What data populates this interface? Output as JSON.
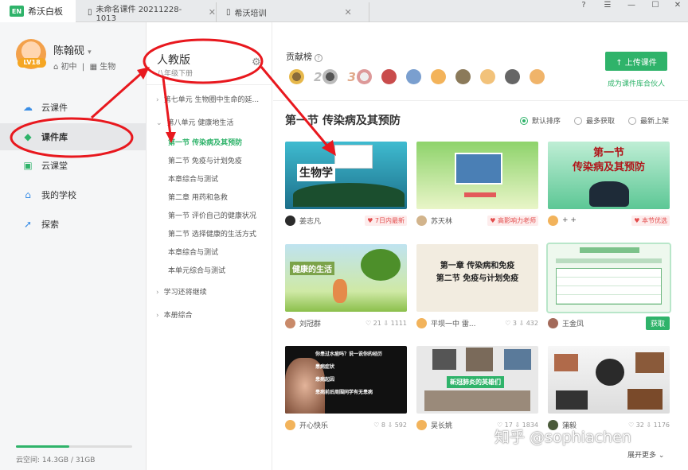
{
  "app": {
    "logo": "EN",
    "name": "希沃白板"
  },
  "tabs": [
    {
      "label": "未命名课件 20211228-1013"
    },
    {
      "label": "希沃培训"
    }
  ],
  "window_controls": {
    "help": "?",
    "min": "—",
    "close": "✕"
  },
  "user": {
    "name": "陈翰砚",
    "level": "LV18",
    "grade": "初中",
    "subject": "生物"
  },
  "nav": [
    {
      "label": "云课件",
      "icon": "cloud-icon"
    },
    {
      "label": "课件库",
      "icon": "library-icon"
    },
    {
      "label": "云课堂",
      "icon": "classroom-icon"
    },
    {
      "label": "我的学校",
      "icon": "school-icon"
    },
    {
      "label": "探索",
      "icon": "rocket-icon"
    }
  ],
  "storage": {
    "text": "云空间: 14.3GB / 31GB",
    "fraction": 0.46
  },
  "textbook": {
    "title": "人教版",
    "subtitle": "八年级下册",
    "tree": [
      "第七单元 生物圈中生命的延...",
      "第八单元 健康地生活",
      "第一节 传染病及其预防",
      "第二节 免疫与计划免疫",
      "本章综合与测试",
      "第二章 用药和急救",
      "第一节 评价自己的健康状况",
      "第二节 选择健康的生活方式",
      "本章综合与测试",
      "本单元综合与测试",
      "学习还将继续",
      "本册综合"
    ]
  },
  "contrib": {
    "label": "贡献榜",
    "help": "?",
    "rank2": "2",
    "rank3": "3"
  },
  "upload_button": "↑ 上传课件",
  "contributor_link": "成为课件库合伙人",
  "section_title": "第一节 传染病及其预防",
  "sort": [
    "默认排序",
    "最多获取",
    "最新上架"
  ],
  "cards": [
    {
      "author": "姜志凡",
      "tag": "♥ 7日内最新",
      "thumb_text": "生物学"
    },
    {
      "author": "苏天林",
      "tag": "♥ 高影响力老师",
      "thumb_text": ""
    },
    {
      "author": "+ +",
      "tag": "♥ 本节优选",
      "thumb_text": "第一节\n传染病及其预防"
    },
    {
      "author": "刘冠群",
      "stats": "♡ 21  ⇩ 1111",
      "thumb_text": "健康的生活"
    },
    {
      "author": "平坝一中 雷...",
      "stats": "♡ 3  ⇩ 432",
      "thumb_text": "第一章 传染病和免疫\n第二节  免疫与计划免疫"
    },
    {
      "author": "王金凤",
      "button": "获取",
      "thumb_text": ""
    },
    {
      "author": "开心快乐",
      "stats": "♡ 8  ⇩ 592",
      "thumb_text": "你患过水痘吗？说一说你的经历\n患病症状\n患病起因\n患病前后周围同学有无患病"
    },
    {
      "author": "吴长姚",
      "stats": "♡ 17  ⇩ 1834",
      "thumb_text": "新冠肺炎的英雄们"
    },
    {
      "author": "蒲毅",
      "stats": "♡ 32  ⇩ 1176",
      "thumb_text": ""
    }
  ],
  "more": "展开更多 ⌄",
  "watermark": "知乎 @sophiachen",
  "colors": {
    "accent": "#2fb36a",
    "annotation": "#e8181e"
  }
}
